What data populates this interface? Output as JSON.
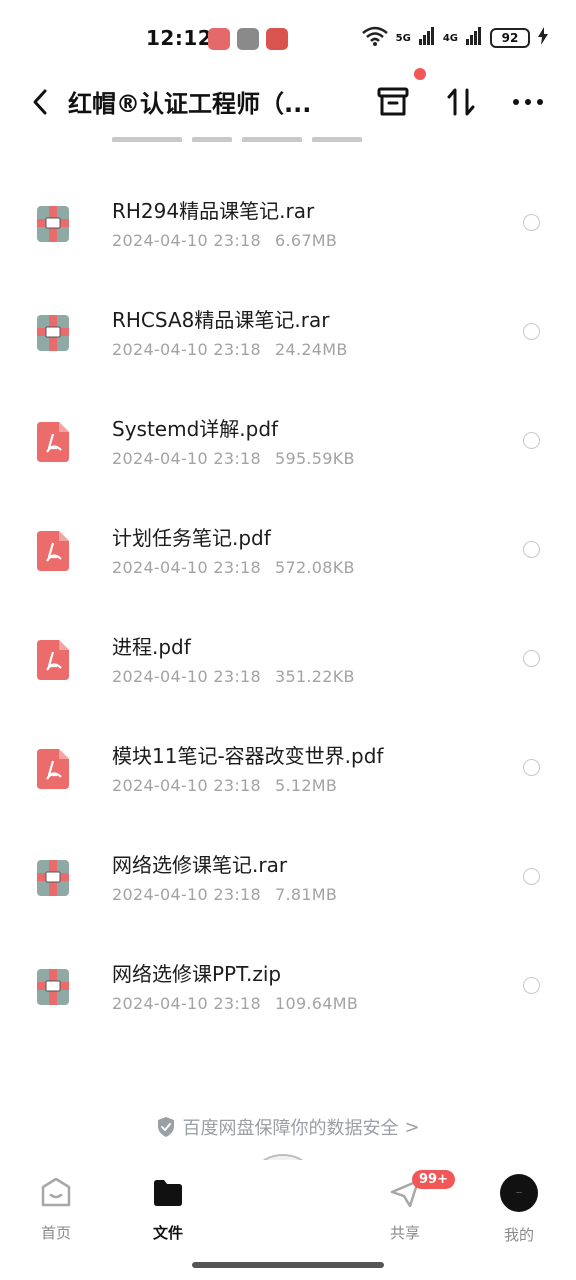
{
  "status_bar": {
    "time": "12:12",
    "signal_1": "5G",
    "signal_2": "4G",
    "battery": "92"
  },
  "header": {
    "title": "红帽®认证工程师（...",
    "back_icon": "back-arrow-icon",
    "recycle_icon": "recycle-bin-icon",
    "sort_icon": "sort-icon",
    "more_icon": "more-icon"
  },
  "files": [
    {
      "name": "RH294精品课笔记.rar",
      "date": "2024-04-10  23:18",
      "size": "6.67MB",
      "type": "rar"
    },
    {
      "name": "RHCSA8精品课笔记.rar",
      "date": "2024-04-10  23:18",
      "size": "24.24MB",
      "type": "rar"
    },
    {
      "name": "Systemd详解.pdf",
      "date": "2024-04-10  23:18",
      "size": "595.59KB",
      "type": "pdf"
    },
    {
      "name": "计划任务笔记.pdf",
      "date": "2024-04-10  23:18",
      "size": "572.08KB",
      "type": "pdf"
    },
    {
      "name": "进程.pdf",
      "date": "2024-04-10  23:18",
      "size": "351.22KB",
      "type": "pdf"
    },
    {
      "name": "模块11笔记-容器改变世界.pdf",
      "date": "2024-04-10  23:18",
      "size": "5.12MB",
      "type": "pdf"
    },
    {
      "name": "网络选修课笔记.rar",
      "date": "2024-04-10  23:18",
      "size": "7.81MB",
      "type": "rar"
    },
    {
      "name": "网络选修课PPT.zip",
      "date": "2024-04-10  23:18",
      "size": "109.64MB",
      "type": "zip"
    }
  ],
  "security": {
    "text": "百度网盘保障你的数据安全",
    "arrow": ">"
  },
  "nav": {
    "home": "首页",
    "files": "文件",
    "share": "共享",
    "share_badge": "99+",
    "mine": "我的"
  },
  "colors": {
    "pdf": "#ec6b6b",
    "archive_body": "#8fa9a4",
    "archive_strap": "#e96b6b",
    "badge": "#f25757"
  }
}
